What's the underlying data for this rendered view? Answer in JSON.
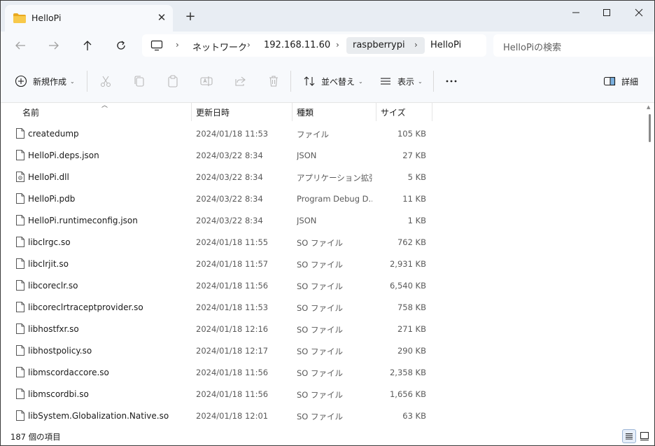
{
  "window": {
    "tab_title": "HelloPi",
    "tab_close": "✕",
    "new_tab": "+"
  },
  "address": {
    "crumbs": [
      "ネットワーク",
      "192.168.11.60",
      "raspberrypi",
      "HelloPi"
    ],
    "separator": "›"
  },
  "search": {
    "placeholder": "HelloPiの検索"
  },
  "toolbar": {
    "new_label": "新規作成",
    "sort_label": "並べ替え",
    "view_label": "表示",
    "more_label": "…",
    "details_label": "詳細"
  },
  "columns": {
    "name": "名前",
    "date": "更新日時",
    "type": "種類",
    "size": "サイズ"
  },
  "files": [
    {
      "name": "createdump",
      "date": "2024/01/18 11:53",
      "type": "ファイル",
      "size": "105 KB",
      "icon": "file-icon"
    },
    {
      "name": "HelloPi.deps.json",
      "date": "2024/03/22 8:34",
      "type": "JSON",
      "size": "27 KB",
      "icon": "file-icon"
    },
    {
      "name": "HelloPi.dll",
      "date": "2024/03/22 8:34",
      "type": "アプリケーション拡張",
      "size": "5 KB",
      "icon": "dll-icon"
    },
    {
      "name": "HelloPi.pdb",
      "date": "2024/03/22 8:34",
      "type": "Program Debug D...",
      "size": "11 KB",
      "icon": "file-icon"
    },
    {
      "name": "HelloPi.runtimeconfig.json",
      "date": "2024/03/22 8:34",
      "type": "JSON",
      "size": "1 KB",
      "icon": "file-icon"
    },
    {
      "name": "libclrgc.so",
      "date": "2024/01/18 11:55",
      "type": "SO ファイル",
      "size": "762 KB",
      "icon": "file-icon"
    },
    {
      "name": "libclrjit.so",
      "date": "2024/01/18 11:57",
      "type": "SO ファイル",
      "size": "2,931 KB",
      "icon": "file-icon"
    },
    {
      "name": "libcoreclr.so",
      "date": "2024/01/18 11:56",
      "type": "SO ファイル",
      "size": "6,540 KB",
      "icon": "file-icon"
    },
    {
      "name": "libcoreclrtraceptprovider.so",
      "date": "2024/01/18 11:53",
      "type": "SO ファイル",
      "size": "758 KB",
      "icon": "file-icon"
    },
    {
      "name": "libhostfxr.so",
      "date": "2024/01/18 12:16",
      "type": "SO ファイル",
      "size": "271 KB",
      "icon": "file-icon"
    },
    {
      "name": "libhostpolicy.so",
      "date": "2024/01/18 12:17",
      "type": "SO ファイル",
      "size": "290 KB",
      "icon": "file-icon"
    },
    {
      "name": "libmscordaccore.so",
      "date": "2024/01/18 11:56",
      "type": "SO ファイル",
      "size": "2,358 KB",
      "icon": "file-icon"
    },
    {
      "name": "libmscordbi.so",
      "date": "2024/01/18 11:56",
      "type": "SO ファイル",
      "size": "1,656 KB",
      "icon": "file-icon"
    },
    {
      "name": "libSystem.Globalization.Native.so",
      "date": "2024/01/18 12:01",
      "type": "SO ファイル",
      "size": "63 KB",
      "icon": "file-icon"
    }
  ],
  "status": {
    "item_count": "187 個の項目"
  },
  "colors": {
    "titlebar": "#e8edf3",
    "toolbar": "#f7f9fc",
    "folder": "#f5c542",
    "accent": "#0067c0"
  }
}
